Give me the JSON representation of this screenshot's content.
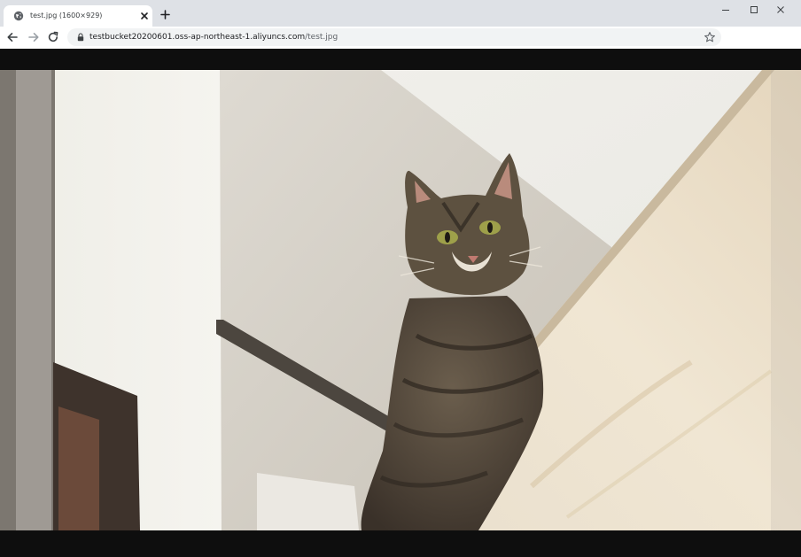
{
  "browser": {
    "tab": {
      "title": "test.jpg (1600×929)",
      "favicon": "globe-icon",
      "close_icon": "close-icon"
    },
    "new_tab_icon": "plus-icon",
    "window_controls": [
      "minimize-icon",
      "maximize-icon",
      "close-icon"
    ],
    "toolbar": {
      "back_icon": "arrow-left-icon",
      "forward_icon": "arrow-right-icon",
      "reload_icon": "reload-icon",
      "lock_icon": "lock-icon",
      "url_host": "testbucket20200601.oss-ap-northeast-1.aliyuncs.com",
      "url_path": "/test.jpg",
      "bookmark_icon": "star-icon"
    }
  },
  "content": {
    "image_alt": "test.jpg",
    "colors": {
      "page_background": "#0e0e0e",
      "wall": "#efeee9",
      "wood": "#e6d8c0",
      "cat_body": "#54493c"
    }
  }
}
